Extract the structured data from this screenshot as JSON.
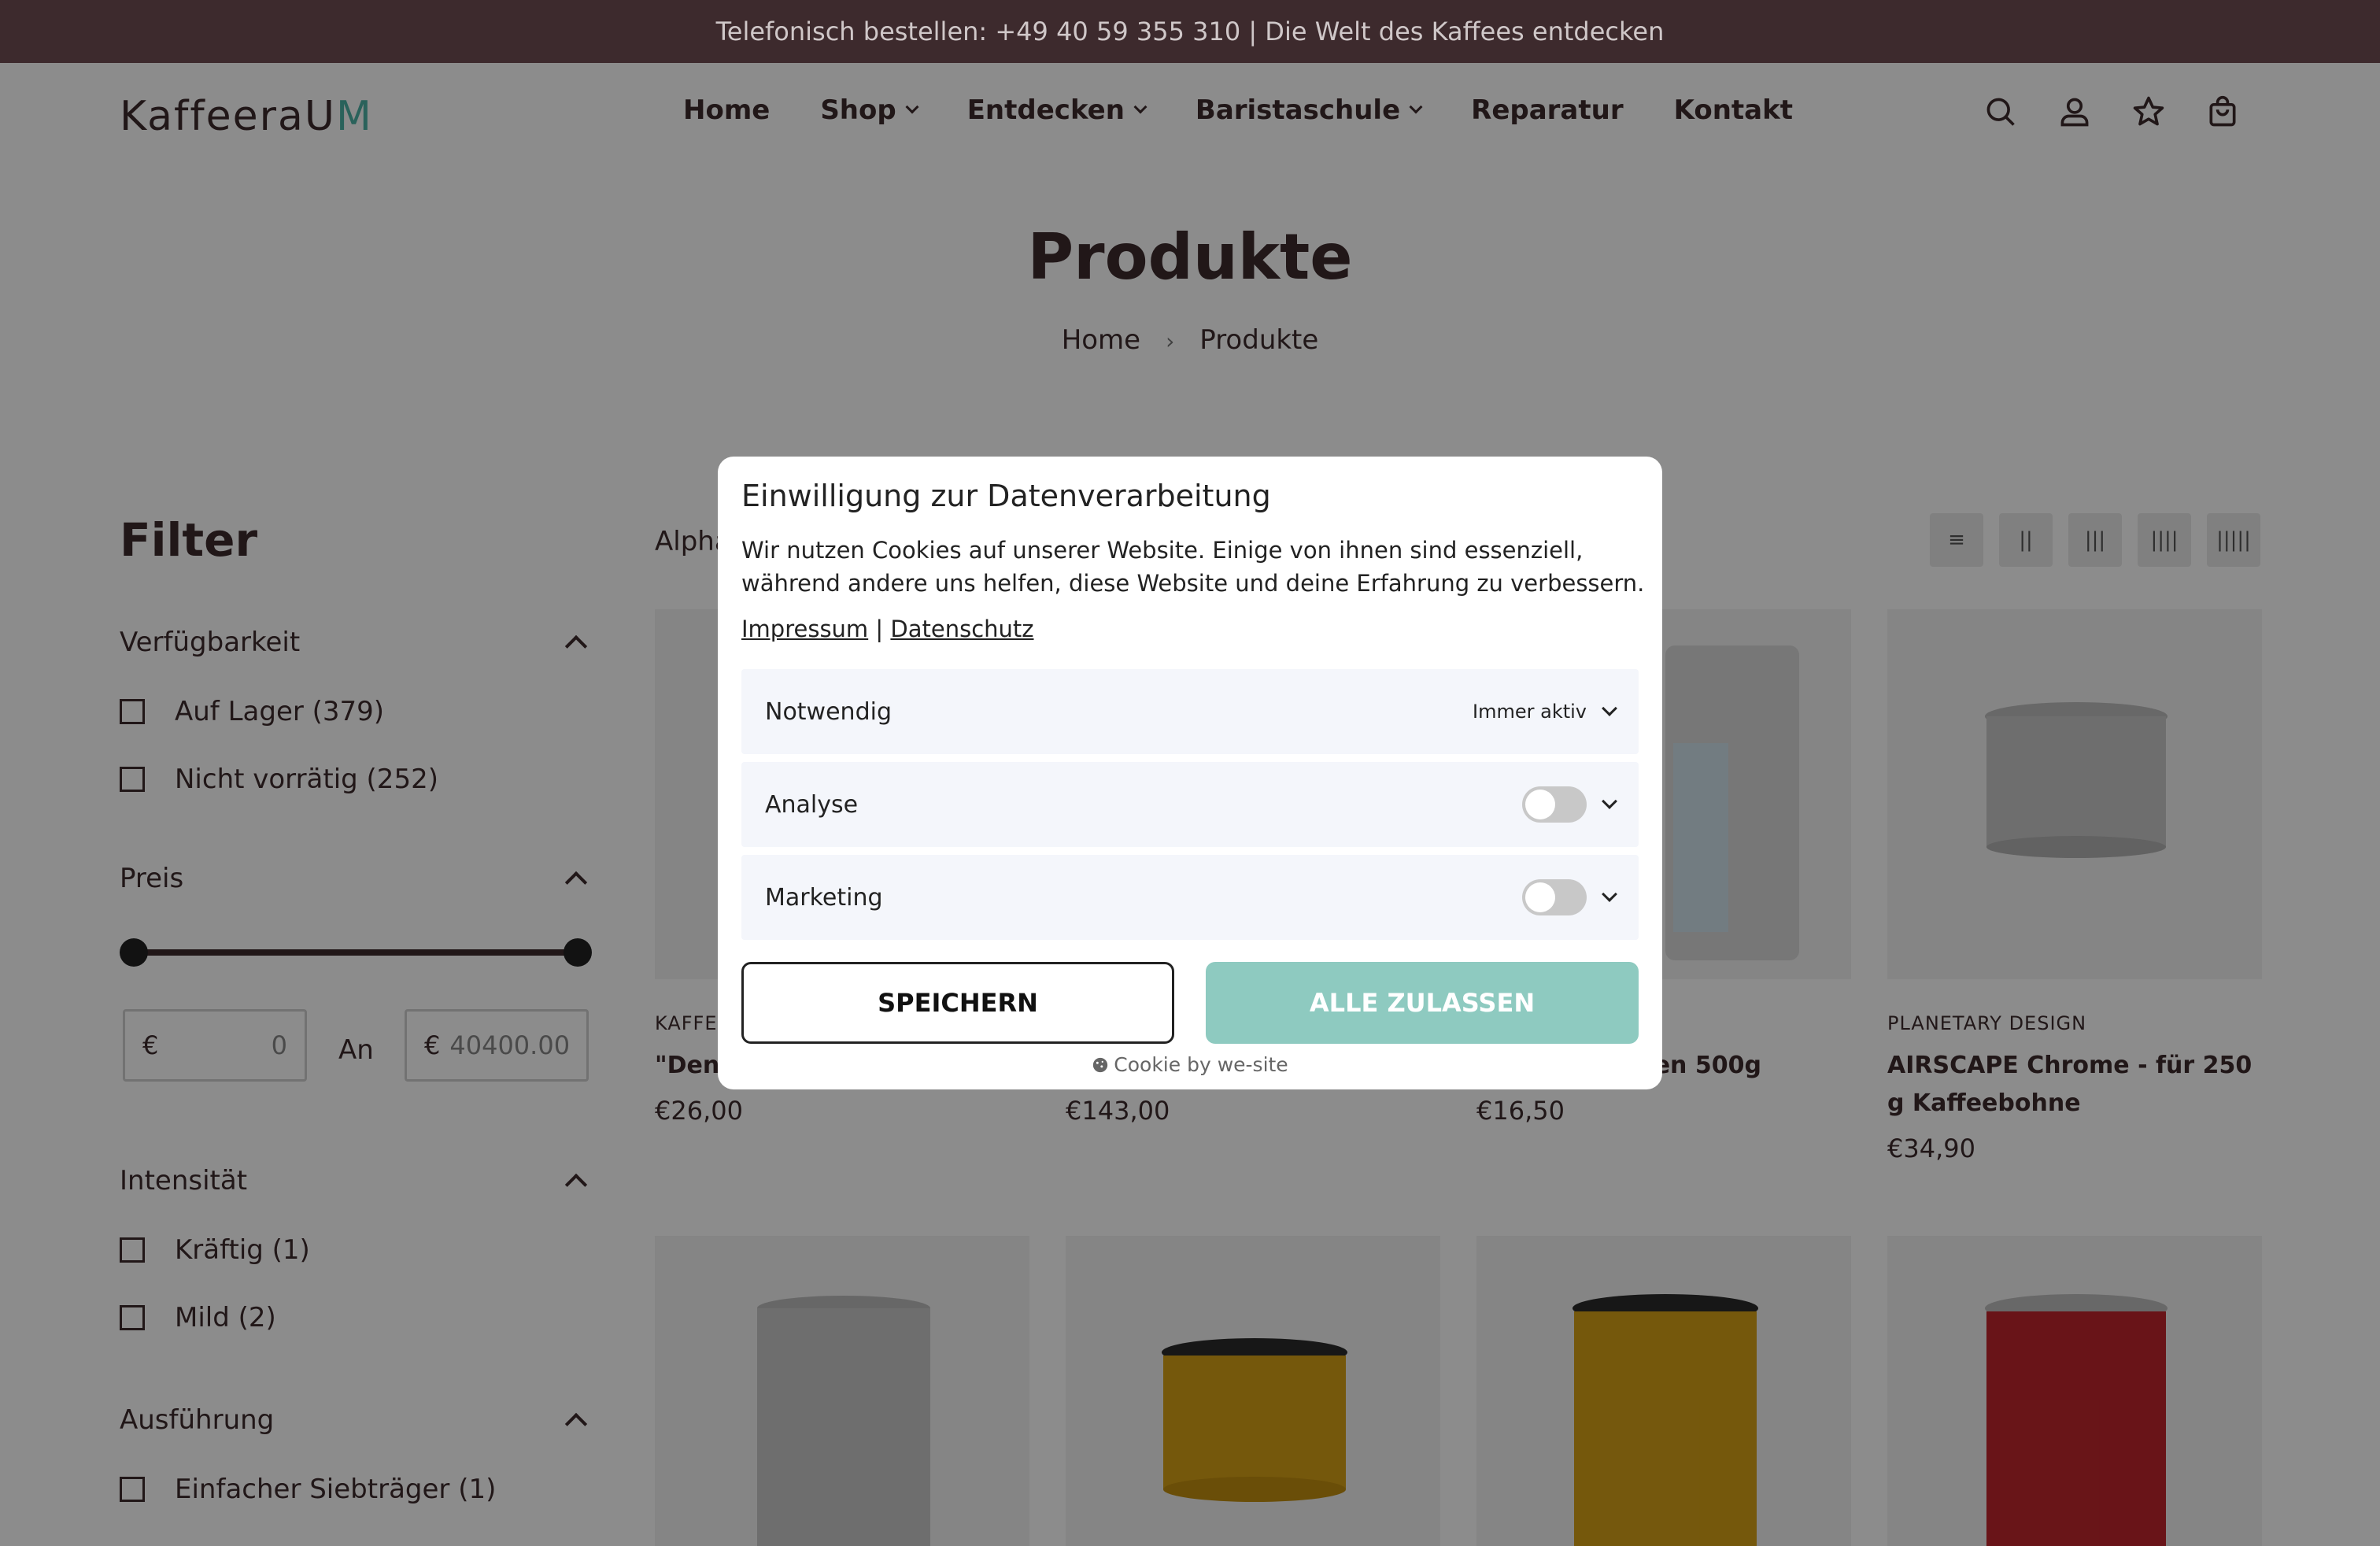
{
  "topbar": {
    "text": "Telefonisch bestellen: +49 40 59 355 310 | Die Welt des Kaffees entdecken"
  },
  "header": {
    "logo_main": "KaffeeraU",
    "logo_accent": "M",
    "nav": [
      {
        "label": "Home",
        "has_dropdown": false
      },
      {
        "label": "Shop",
        "has_dropdown": true
      },
      {
        "label": "Entdecken",
        "has_dropdown": true
      },
      {
        "label": "Baristaschule",
        "has_dropdown": true
      },
      {
        "label": "Reparatur",
        "has_dropdown": false
      },
      {
        "label": "Kontakt",
        "has_dropdown": false
      }
    ],
    "icons": [
      "search-icon",
      "account-icon",
      "wishlist-star-icon",
      "cart-bag-icon"
    ]
  },
  "page": {
    "title": "Produkte",
    "breadcrumb": {
      "home": "Home",
      "current": "Produkte",
      "separator": "›"
    }
  },
  "filter": {
    "title": "Filter",
    "availability": {
      "label": "Verfügbarkeit",
      "options": [
        {
          "label": "Auf Lager (379)"
        },
        {
          "label": "Nicht vorrätig (252)"
        }
      ]
    },
    "price": {
      "label": "Preis",
      "currency": "€",
      "from_value": "0",
      "to_label": "An",
      "to_placeholder": "40400.00"
    },
    "intensity": {
      "label": "Intensität",
      "options": [
        {
          "label": "Kräftig (1)"
        },
        {
          "label": "Mild (2)"
        }
      ]
    },
    "execution": {
      "label": "Ausführung",
      "options": [
        {
          "label": "Einfacher Siebträger (1)"
        }
      ]
    }
  },
  "sort": {
    "label": "Alpha"
  },
  "view_toggles": [
    "≡",
    "||",
    "|||",
    "||||",
    "|||||"
  ],
  "products_row1": [
    {
      "brand": "KAFFEE",
      "title": "\"Den",
      "price": "€26,00"
    },
    {
      "brand": "",
      "title": "",
      "price": "€143,00"
    },
    {
      "brand": "",
      "title": "ssen 500g",
      "price": "€16,50"
    },
    {
      "brand": "PLANETARY DESIGN",
      "title": "AIRSCAPE Chrome - für 250 g Kaffeebohne",
      "price": "€34,90"
    }
  ],
  "colors": {
    "brand_dark": "#3d2a2d",
    "accent_teal": "#8ecac0",
    "overlay": "rgba(0,0,0,0.45)"
  },
  "consent": {
    "title": "Einwilligung zur Datenverarbeitung",
    "description": "Wir nutzen Cookies auf unserer Website. Einige von ihnen sind essenziell, während andere uns helfen, diese Website und deine Erfahrung zu verbessern.",
    "link_impressum": "Impressum",
    "link_separator": "|",
    "link_datenschutz": "Datenschutz",
    "categories": [
      {
        "label": "Notwendig",
        "status": "Immer aktiv"
      },
      {
        "label": "Analyse",
        "enabled": false
      },
      {
        "label": "Marketing",
        "enabled": false
      }
    ],
    "save_label": "SPEICHERN",
    "accept_all_label": "ALLE ZULASSEN",
    "footer": "Cookie by we-site"
  }
}
